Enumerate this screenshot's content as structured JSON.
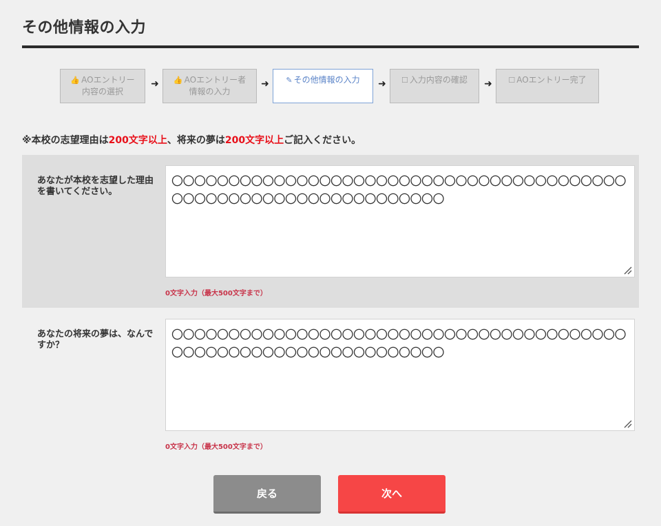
{
  "page": {
    "title": "その他情報の入力"
  },
  "steps": [
    {
      "icon": "thumbs-up-icon",
      "glyph": "👍",
      "line1": "AOエントリー",
      "line2": "内容の選択",
      "active": false
    },
    {
      "icon": "thumbs-up-icon",
      "glyph": "👍",
      "line1": "AOエントリー者",
      "line2": "情報の入力",
      "active": false
    },
    {
      "icon": "edit-icon",
      "glyph": "✎",
      "line1": "その他情報の入力",
      "line2": "",
      "active": true
    },
    {
      "icon": "checkbox-icon",
      "glyph": "☐",
      "line1": "入力内容の確認",
      "line2": "",
      "active": false
    },
    {
      "icon": "checkbox-icon",
      "glyph": "☐",
      "line1": "AOエントリー完了",
      "line2": "",
      "active": false
    }
  ],
  "step_arrow": "➜",
  "notice": {
    "prefix": "※本校の志望理由は",
    "req1": "200文字以上",
    "middle": "、将来の夢は",
    "req2": "200文字以上",
    "suffix": "ご記入ください。"
  },
  "fields": {
    "reason": {
      "label": "あなたが本校を志望した理由を書いてください。",
      "value": "〇〇〇〇〇〇〇〇〇〇〇〇〇〇〇〇〇〇〇〇〇〇〇〇〇〇〇〇〇〇〇〇〇〇〇〇〇〇〇〇〇〇〇〇〇〇〇〇〇〇〇〇〇〇〇〇〇〇〇〇〇〇〇〇",
      "counter": "0文字入力（最大500文字まで）"
    },
    "dream": {
      "label": "あなたの将来の夢は、なんですか？",
      "value": "〇〇〇〇〇〇〇〇〇〇〇〇〇〇〇〇〇〇〇〇〇〇〇〇〇〇〇〇〇〇〇〇〇〇〇〇〇〇〇〇〇〇〇〇〇〇〇〇〇〇〇〇〇〇〇〇〇〇〇〇〇〇〇〇",
      "counter": "0文字入力（最大500文字まで）"
    }
  },
  "buttons": {
    "back": "戻る",
    "next": "次へ"
  }
}
